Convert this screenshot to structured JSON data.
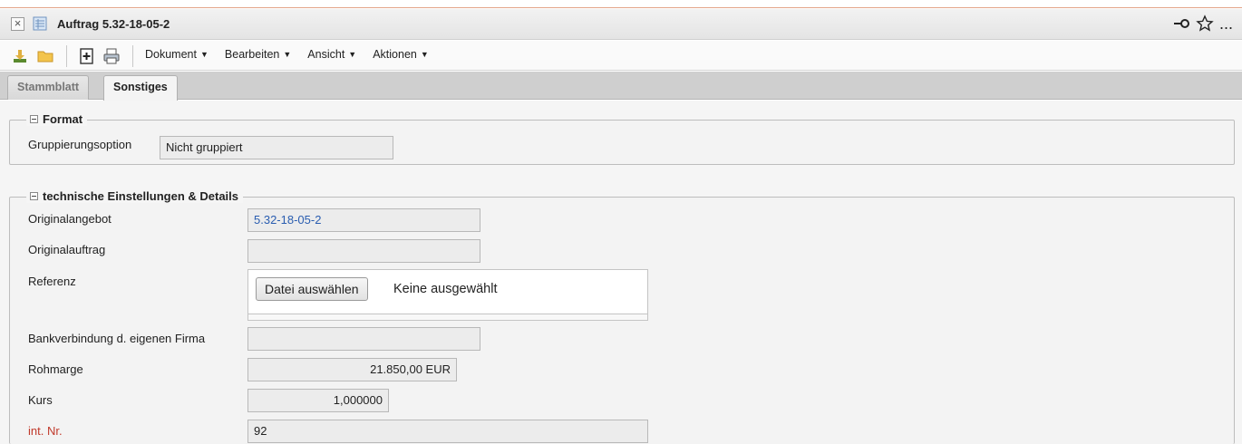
{
  "window": {
    "title": "Auftrag 5.32-18-05-2",
    "more_label": "...",
    "colors": {
      "accent_line": "#e3a488",
      "link": "#2a5db0",
      "required": "#c0392b"
    }
  },
  "toolbar": {
    "icons": [
      "download-icon",
      "folder-icon",
      "new-document-icon",
      "print-icon"
    ],
    "menus": [
      {
        "label": "Dokument"
      },
      {
        "label": "Bearbeiten"
      },
      {
        "label": "Ansicht"
      },
      {
        "label": "Aktionen"
      }
    ]
  },
  "tabs": [
    {
      "label": "Stammblatt",
      "active": false
    },
    {
      "label": "Sonstiges",
      "active": true
    }
  ],
  "format": {
    "legend": "Format",
    "gruppierung_label": "Gruppierungsoption",
    "gruppierung_value": "Nicht gruppiert"
  },
  "technical": {
    "legend": "technische Einstellungen & Details",
    "originalangebot_label": "Originalangebot",
    "originalangebot_value": "5.32-18-05-2",
    "originalauftrag_label": "Originalauftrag",
    "originalauftrag_value": "",
    "referenz_label": "Referenz",
    "file_button_label": "Datei auswählen",
    "file_status": "Keine ausgewählt",
    "bank_label": "Bankverbindung d. eigenen Firma",
    "bank_value": "",
    "rohmarge_label": "Rohmarge",
    "rohmarge_value": "21.850,00 EUR",
    "kurs_label": "Kurs",
    "kurs_value": "1,000000",
    "intnr_label": "int. Nr.",
    "intnr_value": "92"
  }
}
